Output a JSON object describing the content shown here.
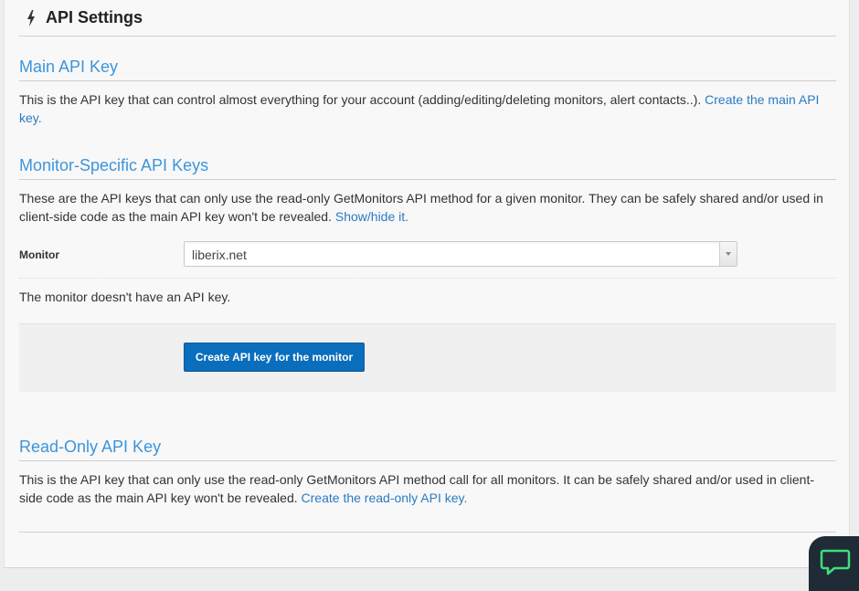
{
  "header": {
    "icon": "bolt-icon",
    "title": "API Settings"
  },
  "main_api": {
    "title": "Main API Key",
    "description": "This is the API key that can control almost everything for your account (adding/editing/deleting monitors, alert contacts..). ",
    "link": "Create the main API key."
  },
  "monitor_api": {
    "title": "Monitor-Specific API Keys",
    "description": "These are the API keys that can only use the read-only GetMonitors API method for a given monitor. They can be safely shared and/or used in client-side code as the main API key won't be revealed. ",
    "link": "Show/hide it.",
    "monitor_label": "Monitor",
    "monitor_value": "liberix.net",
    "no_key_message": "The monitor doesn't have an API key.",
    "create_button": "Create API key for the monitor"
  },
  "readonly_api": {
    "title": "Read-Only API Key",
    "description": "This is the API key that can only use the read-only GetMonitors API method call for all monitors. It can be safely shared and/or used in client-side code as the main API key won't be revealed. ",
    "link": "Create the read-only API key."
  },
  "chat": {
    "icon": "chat-bubble-icon"
  },
  "colors": {
    "accent_heading": "#3c95dc",
    "link": "#2a7bc4",
    "button": "#0a6ebd",
    "chat_widget": "#1f2b36",
    "chat_icon": "#3ee07a"
  }
}
